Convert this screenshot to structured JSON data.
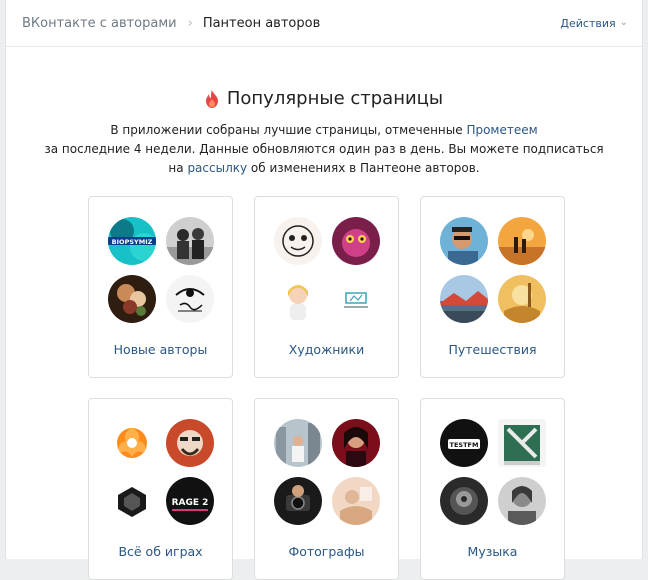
{
  "breadcrumb": {
    "root": "ВКонтакте с авторами",
    "separator": "›",
    "current": "Пантеон авторов"
  },
  "actions_label": "Действия",
  "hero": {
    "title": "Популярные страницы",
    "line1_before": "В приложении собраны лучшие страницы, отмеченные ",
    "line1_link": "Прометеем",
    "line2": "за последние 4 недели. Данные обновляются один раз в день. Вы можете подписаться",
    "line3_before": "на ",
    "line3_link": "рассылку",
    "line3_after": " об изменениях в Пантеоне авторов."
  },
  "avatar_texts": {
    "biopsy": "BIOPSYMIZ",
    "rage": "RAGE 2",
    "testfm": "TESTFM"
  },
  "categories": [
    {
      "label": "Новые авторы"
    },
    {
      "label": "Художники"
    },
    {
      "label": "Путешествия"
    },
    {
      "label": "Всё об играх"
    },
    {
      "label": "Фотографы"
    },
    {
      "label": "Музыка"
    }
  ],
  "colors": {
    "link": "#2a5885",
    "border": "#dbdde2",
    "flame": "#e64646"
  }
}
